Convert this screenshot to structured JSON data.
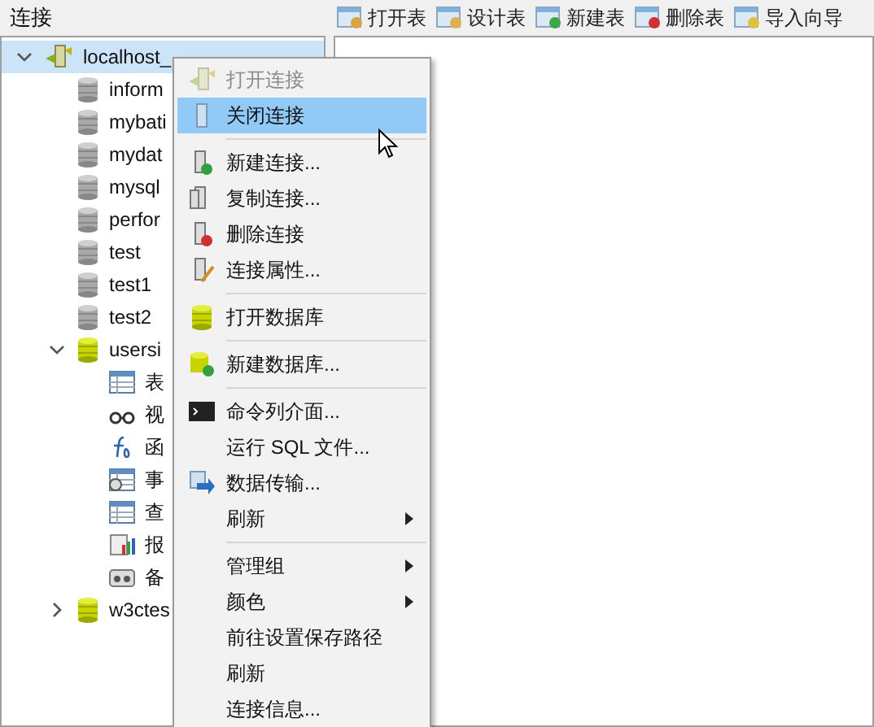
{
  "panel_title": "连接",
  "toolbar": [
    "打开表",
    "设计表",
    "新建表",
    "删除表",
    "导入向导"
  ],
  "tree": [
    {
      "label": "localhost_",
      "kind": "connection",
      "expanded": true,
      "selected": true,
      "children": [
        {
          "label": "inform",
          "kind": "database",
          "open": false
        },
        {
          "label": "mybati",
          "kind": "database",
          "open": false
        },
        {
          "label": "mydat",
          "kind": "database",
          "open": false
        },
        {
          "label": "mysql",
          "kind": "database",
          "open": false
        },
        {
          "label": "perfor",
          "kind": "database",
          "open": false
        },
        {
          "label": "test",
          "kind": "database",
          "open": false
        },
        {
          "label": "test1",
          "kind": "database",
          "open": false
        },
        {
          "label": "test2",
          "kind": "database",
          "open": false
        },
        {
          "label": "usersi",
          "kind": "database",
          "open": true,
          "expanded": true,
          "children": [
            {
              "label": "表",
              "kind": "object"
            },
            {
              "label": "视",
              "kind": "object"
            },
            {
              "label": "函",
              "kind": "object"
            },
            {
              "label": "事",
              "kind": "object"
            },
            {
              "label": "查",
              "kind": "object"
            },
            {
              "label": "报",
              "kind": "object"
            },
            {
              "label": "备",
              "kind": "object"
            }
          ]
        },
        {
          "label": "w3ctes",
          "kind": "database",
          "open": true,
          "expanded": false
        }
      ]
    }
  ],
  "context_menu": [
    {
      "kind": "item",
      "label": "打开连接",
      "disabled": true,
      "selected": false
    },
    {
      "kind": "item",
      "label": "关闭连接",
      "disabled": false,
      "selected": true
    },
    {
      "kind": "separator"
    },
    {
      "kind": "item",
      "label": "新建连接...",
      "disabled": false,
      "selected": false
    },
    {
      "kind": "item",
      "label": "复制连接...",
      "disabled": false,
      "selected": false
    },
    {
      "kind": "item",
      "label": "删除连接",
      "disabled": false,
      "selected": false
    },
    {
      "kind": "item",
      "label": "连接属性...",
      "disabled": false,
      "selected": false
    },
    {
      "kind": "separator"
    },
    {
      "kind": "item",
      "label": "打开数据库",
      "disabled": false,
      "selected": false
    },
    {
      "kind": "separator"
    },
    {
      "kind": "item",
      "label": "新建数据库...",
      "disabled": false,
      "selected": false
    },
    {
      "kind": "separator"
    },
    {
      "kind": "item",
      "label": "命令列介面...",
      "disabled": false,
      "selected": false
    },
    {
      "kind": "item",
      "label": "运行 SQL 文件...",
      "disabled": false,
      "selected": false
    },
    {
      "kind": "item",
      "label": "数据传输...",
      "disabled": false,
      "selected": false
    },
    {
      "kind": "submenu",
      "label": "刷新",
      "disabled": false,
      "selected": false
    },
    {
      "kind": "separator"
    },
    {
      "kind": "submenu",
      "label": "管理组",
      "disabled": false,
      "selected": false
    },
    {
      "kind": "submenu",
      "label": "颜色",
      "disabled": false,
      "selected": false
    },
    {
      "kind": "item",
      "label": "前往设置保存路径",
      "disabled": false,
      "selected": false
    },
    {
      "kind": "item",
      "label": "刷新",
      "disabled": false,
      "selected": false
    },
    {
      "kind": "item",
      "label": "连接信息...",
      "disabled": false,
      "selected": false
    }
  ]
}
